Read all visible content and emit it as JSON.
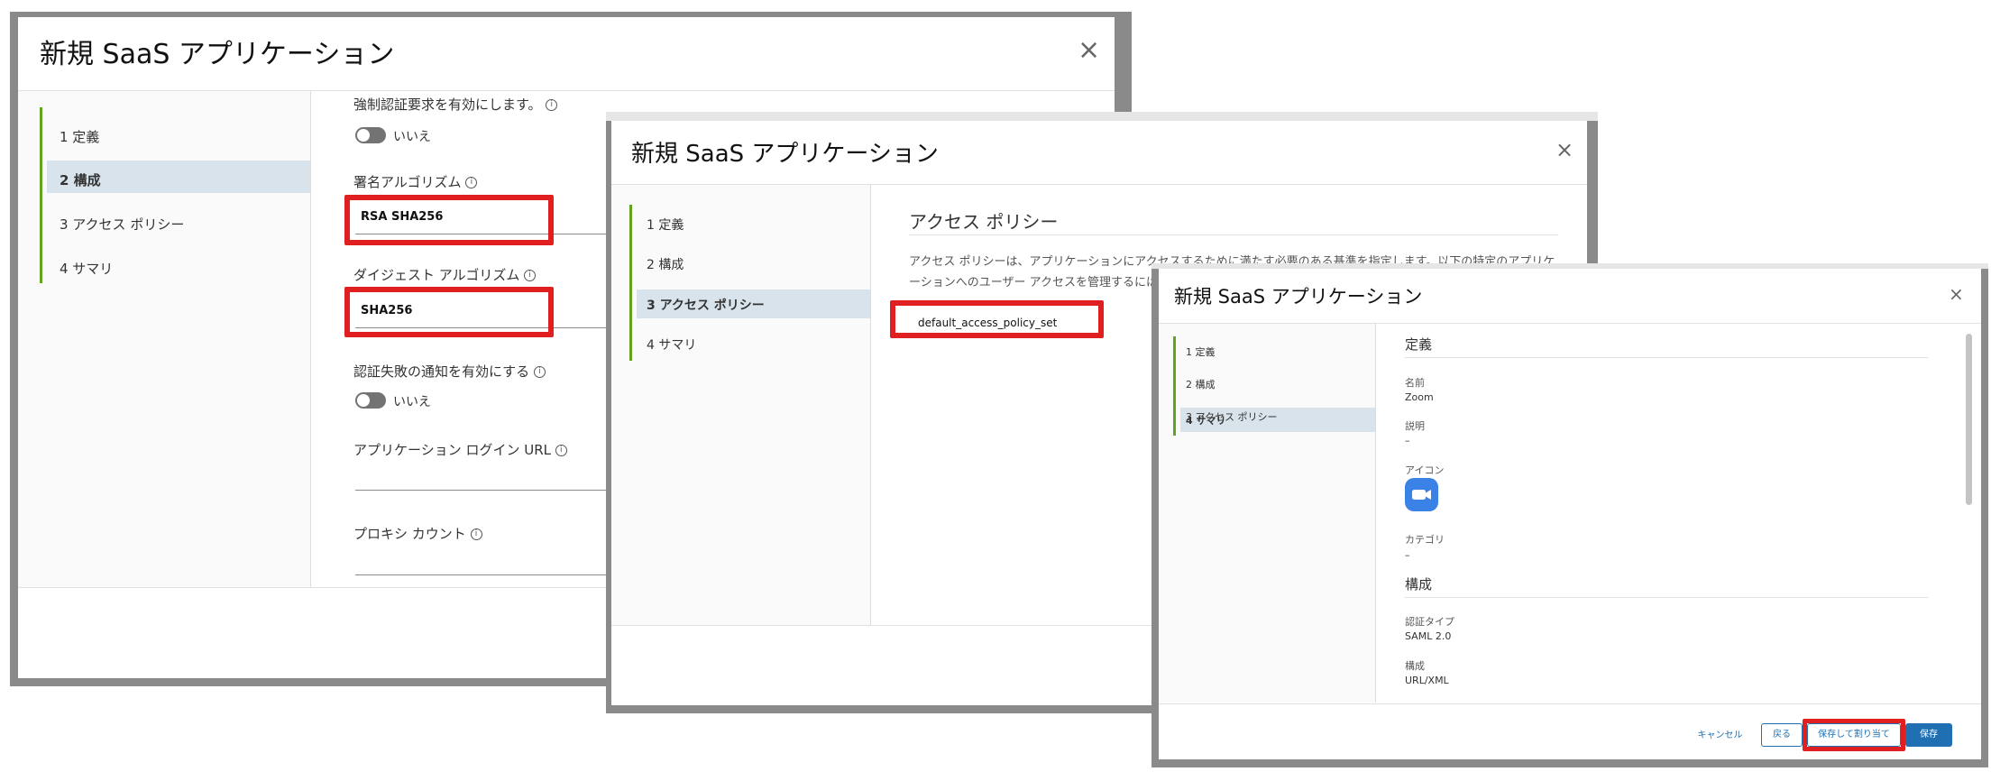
{
  "dialog1": {
    "title": "新規 SaaS アプリケーション",
    "close": "×",
    "steps": [
      "1 定義",
      "2 構成",
      "3 アクセス ポリシー",
      "4 サマリ"
    ],
    "force_auth_label": "強制認証要求を有効にします。",
    "force_auth_value": "いいえ",
    "signing_label": "署名アルゴリズム",
    "signing_value": "RSA SHA256",
    "digest_label": "ダイジェスト アルゴリズム",
    "digest_value": "SHA256",
    "auth_fail_label": "認証失敗の通知を有効にする",
    "auth_fail_value": "いいえ",
    "login_url_label": "アプリケーション ログイン URL",
    "proxy_label": "プロキシ カウント",
    "info_glyph": "i"
  },
  "dialog2": {
    "title": "新規 SaaS アプリケーション",
    "close": "×",
    "steps": [
      "1 定義",
      "2 構成",
      "3 アクセス ポリシー",
      "4 サマリ"
    ],
    "section_title": "アクセス ポリシー",
    "desc_line1": "アクセス ポリシーは、アプリケーションにアクセスするために満たす必要のある基準を指定します。以下の特定のアプリケ",
    "desc_line2": "ーションへのユーザー アクセスを管理するには",
    "policy_value": "default_access_policy_set"
  },
  "dialog3": {
    "title": "新規 SaaS アプリケーション",
    "close": "×",
    "steps": [
      "1 定義",
      "2 構成",
      "3 アクセス ポリシー",
      "4 サマリ"
    ],
    "def_header": "定義",
    "name_label": "名前",
    "name_value": "Zoom",
    "desc_label": "説明",
    "desc_value": "–",
    "icon_label": "アイコン",
    "category_label": "カテゴリ",
    "category_value": "–",
    "config_header": "構成",
    "auth_type_label": "認証タイプ",
    "auth_type_value": "SAML 2.0",
    "config_label": "構成",
    "config_value": "URL/XML",
    "cancel": "キャンセル",
    "back": "戻る",
    "save_assign": "保存して割り当て",
    "save": "保存"
  },
  "colors": {
    "accent_green": "#62a420",
    "active_step": "#d8e3eb",
    "highlight_red": "#e02020",
    "primary_blue": "#1f6fb2",
    "zoom_blue": "#3b82e6"
  }
}
